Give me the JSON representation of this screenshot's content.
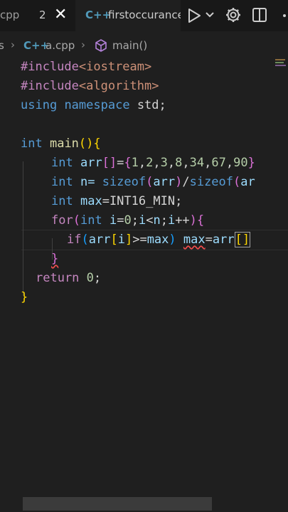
{
  "tabs": {
    "first_tab_label": "cpp",
    "second_tab_badge": "2",
    "active_tab_icon": "C++",
    "active_tab_label": "firstoccurance"
  },
  "toolbar": {
    "run_icon": "play-icon",
    "run_dropdown_icon": "chevron-down-icon",
    "settings_icon": "gear-icon",
    "split_icon": "split-editor-icon"
  },
  "breadcrumb": {
    "folder": "s",
    "file_icon": "C++",
    "file": "a.cpp",
    "symbol_icon": "cube-icon",
    "symbol": "main()"
  },
  "code": {
    "l1_a": "#include",
    "l1_b": "<iostream>",
    "l2_a": "#include",
    "l2_b": "<algorithm>",
    "l3_a": "using",
    "l3_b": "namespace",
    "l3_c": "std;",
    "l5_a": "int",
    "l5_b": "main",
    "l5_c": "(",
    "l5_d": ")",
    "l5_e": "{",
    "l6_a": "int",
    "l6_b": "arr",
    "l6_c": "[]",
    "l6_d": "=",
    "l6_e": "{",
    "l6_f": "1",
    "l6_g": "2",
    "l6_h": "3",
    "l6_i": "8",
    "l6_j": "34",
    "l6_k": "67",
    "l6_l": "90",
    "l6_m": "}",
    "l7_a": "int",
    "l7_b": "n=",
    "l7_c": "sizeof",
    "l7_d": "arr",
    "l7_e": "sizeof",
    "l7_f": "ar",
    "l8_a": "int",
    "l8_b": "max",
    "l8_c": "INT16_MIN",
    "l9_a": "for",
    "l9_b": "int",
    "l9_c": "i",
    "l9_d": "0",
    "l9_e": "i",
    "l9_f": "n",
    "l9_g": "i",
    "l10_a": "if",
    "l10_b": "arr",
    "l10_c": "i",
    "l10_d": "max",
    "l10_e": "max",
    "l10_f": "arr",
    "l12_a": "return",
    "l12_b": "0"
  },
  "colors": {
    "background": "#1f1f1f",
    "keyword": "#569cd6",
    "preprocessor": "#c586c0",
    "string": "#ce9178",
    "number": "#b5cea8",
    "function": "#dcdcaa",
    "variable": "#9cdcfe",
    "bracket_gold": "#ffd700",
    "bracket_pink": "#da70d6",
    "bracket_blue": "#179fff",
    "error_squiggle": "#f14c4c"
  }
}
